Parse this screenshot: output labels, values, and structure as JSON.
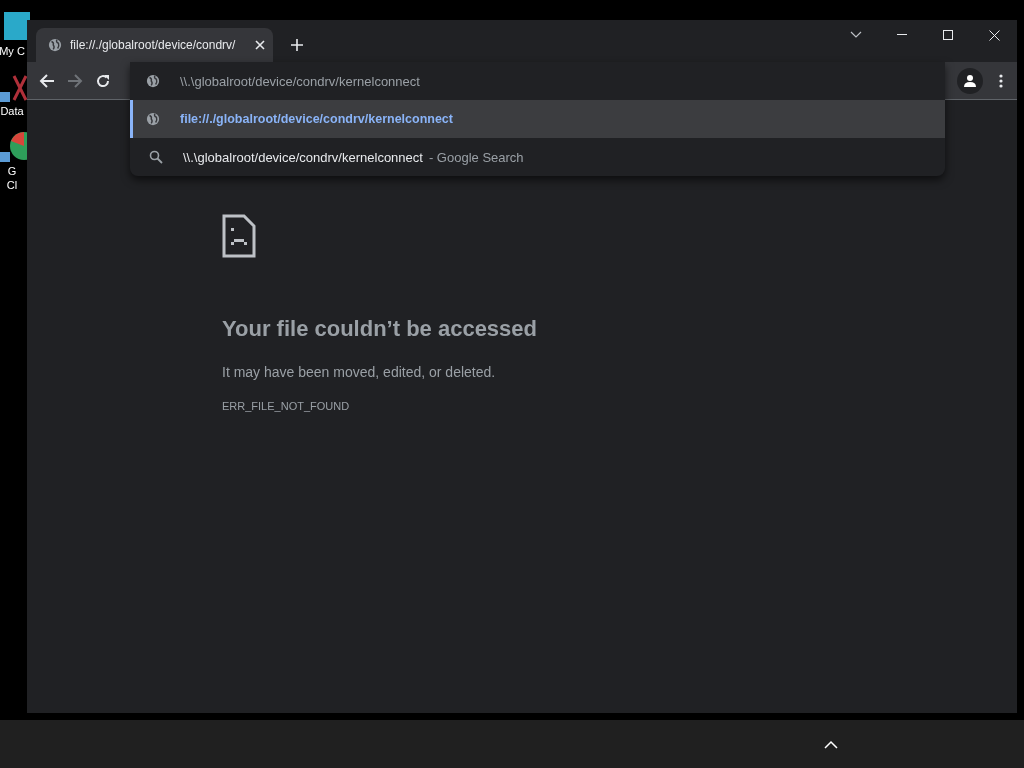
{
  "desktop_icons": [
    {
      "lines": [
        "My C"
      ]
    },
    {
      "lines": [
        "Data"
      ]
    },
    {
      "lines": [
        "G",
        "Cl"
      ]
    }
  ],
  "tabs": [
    {
      "title": "file://./globalroot/device/condrv/",
      "selected": true
    }
  ],
  "omnibox": {
    "value": "\\\\.\\globalroot/device/condrv/kernelconnect"
  },
  "suggestions": [
    {
      "kind": "url",
      "text": "file://./globalroot/device/condrv/kernelconnect",
      "selected": true
    },
    {
      "kind": "search",
      "text": "\\\\.\\globalroot/device/condrv/kernelconnect",
      "suffix": "- Google Search",
      "selected": false
    }
  ],
  "error_page": {
    "title": "Your file couldn’t be accessed",
    "message": "It may have been moved, edited, or deleted.",
    "code": "ERR_FILE_NOT_FOUND"
  }
}
